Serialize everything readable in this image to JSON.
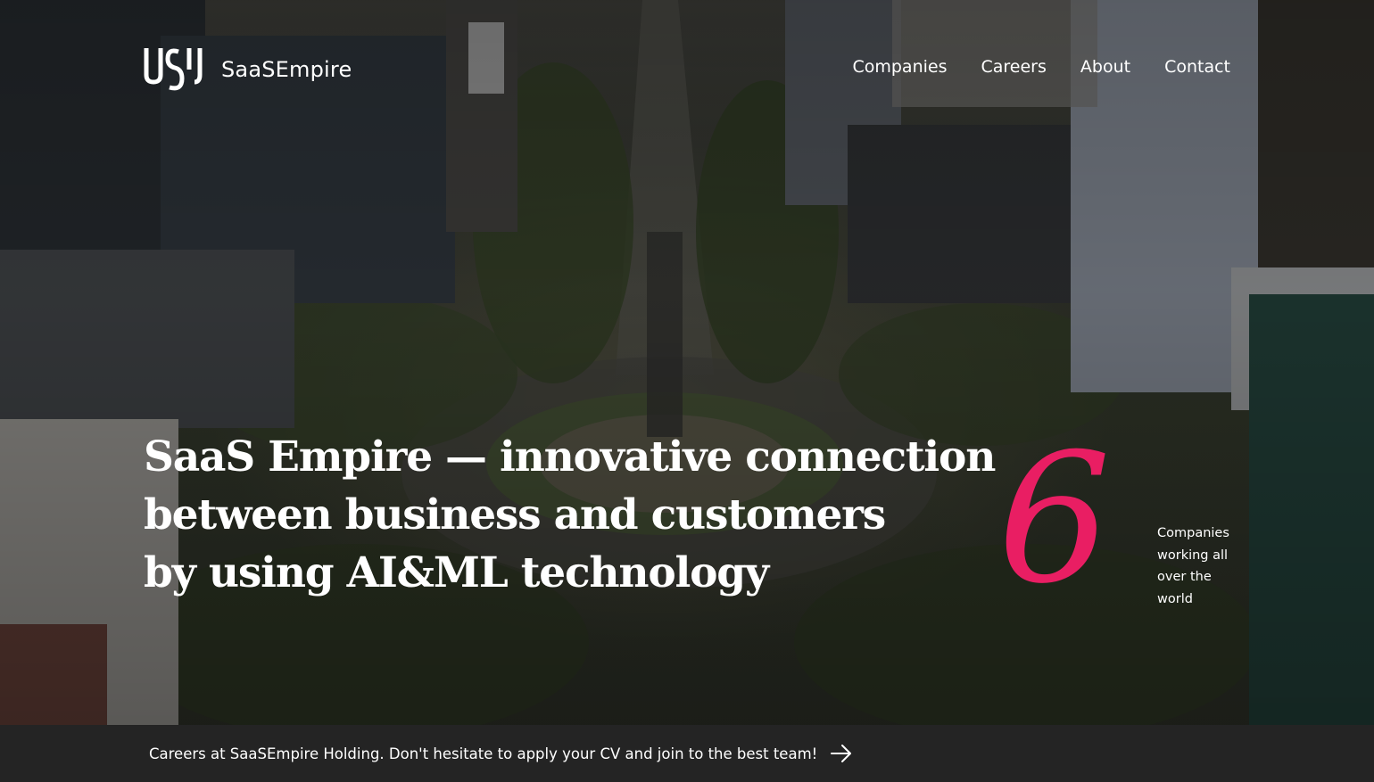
{
  "brand": {
    "name": "SaaSEmpire"
  },
  "nav": {
    "items": [
      {
        "label": "Companies"
      },
      {
        "label": "Careers"
      },
      {
        "label": "About"
      },
      {
        "label": "Contact"
      }
    ]
  },
  "hero": {
    "headline_lines": [
      "SaaS Empire — innovative connection",
      "between business and customers",
      "by using AI&ML technology"
    ],
    "stat": {
      "number": "6",
      "caption": "Companies working all over the world",
      "color": "#e91e63"
    }
  },
  "footer": {
    "text": "Careers at SaaSEmpire Holding. Don't hesitate to apply your CV and join to the best team!",
    "arrow_icon": "arrow-right-icon"
  }
}
